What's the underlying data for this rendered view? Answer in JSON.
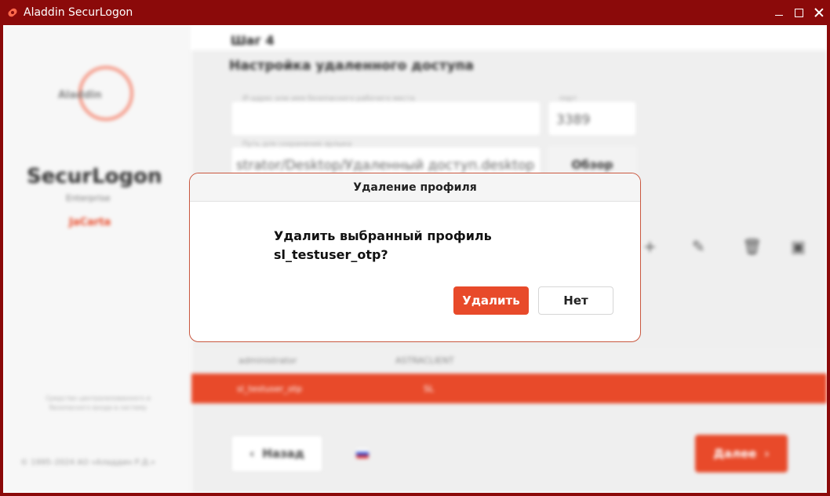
{
  "window": {
    "title": "Aladdin SecurLogon"
  },
  "sidebar": {
    "logo_text": "Aladdin",
    "brand": "SecurLogon",
    "brand_sub": "Enterprise",
    "brand_jc": "JaCarta",
    "note": "Средство централизованного и безопасного входа в систему",
    "copyright": "© 1995–2024 АО «Аладдин Р.Д.»"
  },
  "main": {
    "step": "Шаг 4",
    "title": "Настройка удаленного доступа",
    "host_field": {
      "label": "IP-адрес или имя безопасного рабочего места",
      "value": ""
    },
    "port_field": {
      "label": "порт",
      "value": "3389"
    },
    "path_field": {
      "label": "Путь для сохранения ярлыка",
      "value": "strator/Desktop/Удаленный доступ.desktop"
    },
    "browse_label": "Обзор",
    "table": {
      "headers": [
        "administrator",
        "ASTRACLIENT"
      ],
      "selected_row": [
        "sl_testuser_otp",
        "SL"
      ]
    },
    "back_label": "Назад",
    "next_label": "Далее"
  },
  "dialog": {
    "title": "Удаление профиля",
    "message_line1": "Удалить выбранный профиль",
    "message_line2": "sl_testuser_otp?",
    "confirm_label": "Удалить",
    "cancel_label": "Нет"
  },
  "colors": {
    "frame": "#8b0a0a",
    "accent": "#e84a2a"
  }
}
